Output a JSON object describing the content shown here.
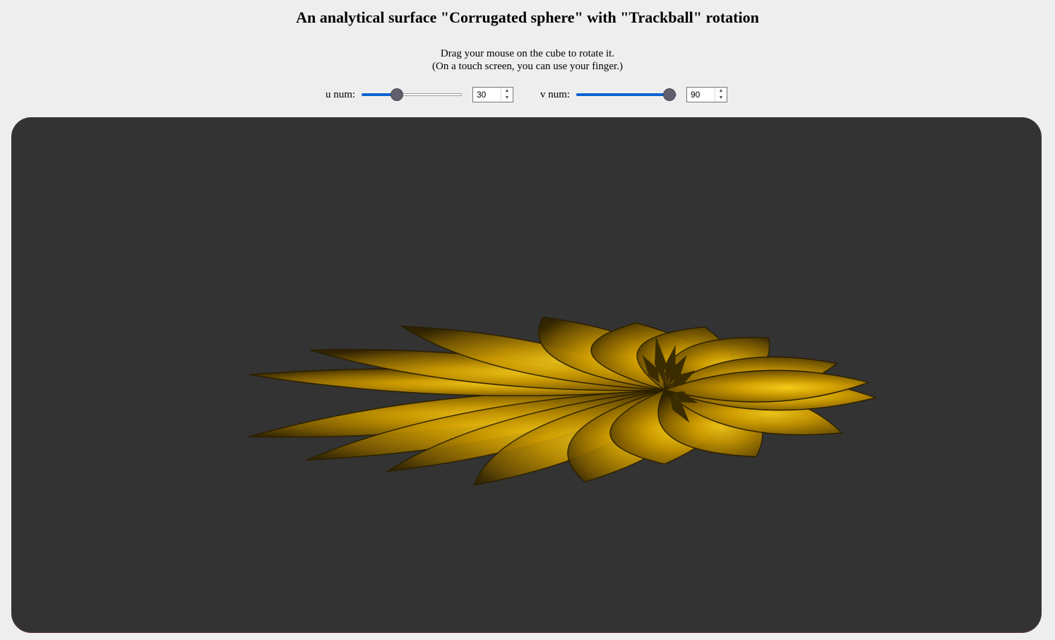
{
  "page": {
    "title": "An analytical surface \"Corrugated sphere\" with \"Trackball\" rotation",
    "instructions_line1": "Drag your mouse on the cube to rotate it.",
    "instructions_line2": "(On a touch screen, you can use your finger.)"
  },
  "controls": {
    "u": {
      "label": "u num:",
      "value": "30",
      "fraction": 0.35
    },
    "v": {
      "label": "v num:",
      "value": "90",
      "fraction": 0.93
    }
  },
  "viewport": {
    "background": "#333333",
    "surface_color": "#c89b00",
    "surface_name": "Corrugated sphere"
  }
}
